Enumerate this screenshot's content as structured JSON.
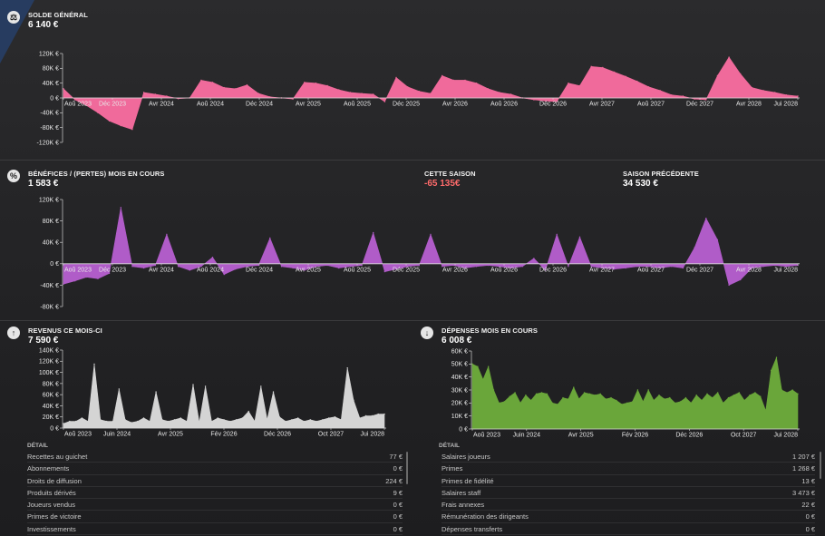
{
  "panels": {
    "balance": {
      "icon": "scale-icon",
      "glyph": "⚖",
      "title": "SOLDE GÉNÉRAL",
      "value": "6 140 €"
    },
    "profit": {
      "icon": "percent-icon",
      "glyph": "%",
      "title": "BÉNÉFICES / (PERTES) MOIS EN COURS",
      "value": "1 583 €",
      "season_label": "CETTE SAISON",
      "season_value": "-65 135€",
      "prev_label": "SAISON PRÉCÉDENTE",
      "prev_value": "34 530 €"
    },
    "income": {
      "icon": "arrow-up-icon",
      "glyph": "↑",
      "title": "REVENUS CE MOIS-CI",
      "value": "7 590 €"
    },
    "expenses": {
      "icon": "arrow-down-icon",
      "glyph": "↓",
      "title": "DÉPENSES MOIS EN COURS",
      "value": "6 008 €"
    }
  },
  "income_detail": {
    "title": "DÉTAIL",
    "rows": [
      {
        "name": "Recettes au guichet",
        "value": "77 €"
      },
      {
        "name": "Abonnements",
        "value": "0 €"
      },
      {
        "name": "Droits de diffusion",
        "value": "224 €"
      },
      {
        "name": "Produits dérivés",
        "value": "9 €"
      },
      {
        "name": "Joueurs vendus",
        "value": "0 €"
      },
      {
        "name": "Primes de victoire",
        "value": "0 €"
      },
      {
        "name": "Investissements",
        "value": "0 €"
      }
    ]
  },
  "expense_detail": {
    "title": "DÉTAIL",
    "rows": [
      {
        "name": "Salaires joueurs",
        "value": "1 207 €"
      },
      {
        "name": "Primes",
        "value": "1 268 €"
      },
      {
        "name": "Primes de fidélité",
        "value": "13 €"
      },
      {
        "name": "Salaires staff",
        "value": "3 473 €"
      },
      {
        "name": "Frais annexes",
        "value": "22 €"
      },
      {
        "name": "Rémunération des dirigeants",
        "value": "0 €"
      },
      {
        "name": "Dépenses transferts",
        "value": "0 €"
      }
    ]
  },
  "chart_data": [
    {
      "id": "balance",
      "type": "area",
      "color": "#f06a9b",
      "ylim": [
        -120000,
        120000
      ],
      "yticks": [
        {
          "v": 120000,
          "label": "120K €"
        },
        {
          "v": 80000,
          "label": "80K €"
        },
        {
          "v": 40000,
          "label": "40K €"
        },
        {
          "v": 0,
          "label": "0 €"
        },
        {
          "v": -40000,
          "label": "-40K €"
        },
        {
          "v": -80000,
          "label": "-80K €"
        },
        {
          "v": -120000,
          "label": "-120K €"
        }
      ],
      "xticks": [
        "Aoû 2023",
        "Déc 2023",
        "Avr 2024",
        "Aoû 2024",
        "Déc 2024",
        "Avr 2025",
        "Aoû 2025",
        "Déc 2025",
        "Avr 2026",
        "Aoû 2026",
        "Déc 2026",
        "Avr 2027",
        "Aoû 2027",
        "Déc 2027",
        "Avr 2028",
        "Jui 2028"
      ],
      "values": [
        25000,
        -5000,
        -20000,
        -40000,
        -62000,
        -75000,
        -85000,
        15000,
        10000,
        5000,
        -2000,
        0,
        48000,
        42000,
        28000,
        25000,
        35000,
        12000,
        3000,
        0,
        -3000,
        42000,
        40000,
        33000,
        22000,
        15000,
        12000,
        10000,
        -10000,
        55000,
        30000,
        18000,
        12000,
        60000,
        48000,
        48000,
        40000,
        25000,
        15000,
        10000,
        0,
        -5000,
        -8000,
        -10000,
        40000,
        33000,
        85000,
        82000,
        70000,
        58000,
        45000,
        30000,
        20000,
        8000,
        5000,
        -3000,
        -5000,
        60000,
        110000,
        65000,
        28000,
        20000,
        15000,
        8000,
        5000
      ]
    },
    {
      "id": "profit",
      "type": "area",
      "color": "#b05cc8",
      "ylim": [
        -80000,
        120000
      ],
      "yticks": [
        {
          "v": 120000,
          "label": "120K €"
        },
        {
          "v": 80000,
          "label": "80K €"
        },
        {
          "v": 40000,
          "label": "40K €"
        },
        {
          "v": 0,
          "label": "0 €"
        },
        {
          "v": -40000,
          "label": "-40K €"
        },
        {
          "v": -80000,
          "label": "-80K €"
        }
      ],
      "xticks": [
        "Aoû 2023",
        "Déc 2023",
        "Avr 2024",
        "Aoû 2024",
        "Déc 2024",
        "Avr 2025",
        "Aoû 2025",
        "Déc 2025",
        "Avr 2026",
        "Aoû 2026",
        "Déc 2026",
        "Avr 2027",
        "Aoû 2027",
        "Déc 2027",
        "Avr 2028",
        "Jui 2028"
      ],
      "values": [
        -38000,
        -32000,
        -25000,
        -28000,
        -18000,
        105000,
        -5000,
        -8000,
        -3000,
        55000,
        -5000,
        -12000,
        -5000,
        12000,
        -20000,
        -10000,
        -5000,
        -3000,
        48000,
        -5000,
        -8000,
        -12000,
        -5000,
        -3000,
        -8000,
        -5000,
        -3000,
        58000,
        -15000,
        -10000,
        -5000,
        -3000,
        55000,
        -5000,
        -3000,
        -8000,
        -5000,
        -3000,
        -5000,
        -8000,
        -5000,
        10000,
        -12000,
        55000,
        -5000,
        50000,
        -5000,
        -8000,
        -10000,
        -8000,
        -5000,
        -5000,
        -8000,
        -5000,
        -8000,
        30000,
        85000,
        45000,
        -40000,
        -30000,
        -8000,
        -5000,
        -3000,
        -5000,
        -3000
      ]
    },
    {
      "id": "income",
      "type": "area",
      "color": "#d4d4d4",
      "ylim": [
        0,
        140000
      ],
      "yticks": [
        {
          "v": 140000,
          "label": "140K €"
        },
        {
          "v": 120000,
          "label": "120K €"
        },
        {
          "v": 100000,
          "label": "100K €"
        },
        {
          "v": 80000,
          "label": "80K €"
        },
        {
          "v": 60000,
          "label": "60K €"
        },
        {
          "v": 40000,
          "label": "40K €"
        },
        {
          "v": 20000,
          "label": "20K €"
        },
        {
          "v": 0,
          "label": "0 €"
        }
      ],
      "xticks": [
        "Aoû 2023",
        "Juin 2024",
        "Avr 2025",
        "Fév 2026",
        "Déc 2026",
        "Oct 2027",
        "Jui 2028"
      ],
      "values": [
        8000,
        12000,
        12000,
        18000,
        12000,
        115000,
        15000,
        12000,
        12000,
        70000,
        15000,
        10000,
        12000,
        18000,
        12000,
        65000,
        15000,
        12000,
        15000,
        18000,
        12000,
        78000,
        10000,
        75000,
        12000,
        18000,
        15000,
        12000,
        15000,
        18000,
        30000,
        12000,
        75000,
        15000,
        65000,
        20000,
        12000,
        15000,
        18000,
        12000,
        15000,
        12000,
        15000,
        18000,
        20000,
        15000,
        108000,
        50000,
        18000,
        22000,
        22000,
        25000,
        25000
      ]
    },
    {
      "id": "expenses",
      "type": "area",
      "color": "#6aa63a",
      "ylim": [
        0,
        60000
      ],
      "yticks": [
        {
          "v": 60000,
          "label": "60K €"
        },
        {
          "v": 50000,
          "label": "50K €"
        },
        {
          "v": 40000,
          "label": "40K €"
        },
        {
          "v": 30000,
          "label": "30K €"
        },
        {
          "v": 20000,
          "label": "20K €"
        },
        {
          "v": 10000,
          "label": "10K €"
        },
        {
          "v": 0,
          "label": "0 €"
        }
      ],
      "xticks": [
        "Aoû 2023",
        "Juin 2024",
        "Avr 2025",
        "Fév 2026",
        "Déc 2026",
        "Oct 2027",
        "Jui 2028"
      ],
      "values": [
        50000,
        48000,
        38000,
        48000,
        30000,
        20000,
        21000,
        25000,
        28000,
        20000,
        26000,
        22000,
        27000,
        28000,
        27000,
        20000,
        19000,
        24000,
        23000,
        32000,
        23000,
        28000,
        27000,
        26000,
        27000,
        23000,
        24000,
        22000,
        19000,
        20000,
        21000,
        30000,
        21000,
        30000,
        22000,
        26000,
        23000,
        24000,
        20000,
        21000,
        24000,
        20000,
        26000,
        22000,
        27000,
        24000,
        28000,
        20000,
        24000,
        26000,
        28000,
        22000,
        26000,
        28000,
        25000,
        14000,
        45000,
        55000,
        30000,
        28000,
        30000,
        27000
      ]
    }
  ]
}
